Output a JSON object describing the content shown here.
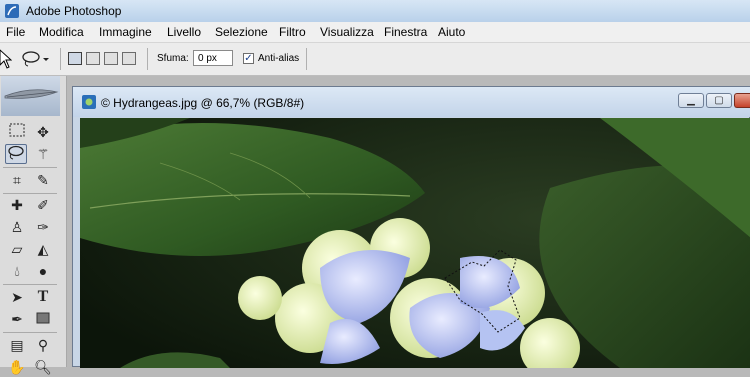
{
  "window": {
    "title": "Adobe Photoshop"
  },
  "menu": {
    "items": [
      "File",
      "Modifica",
      "Immagine",
      "Livello",
      "Selezione",
      "Filtro",
      "Visualizza",
      "Finestra",
      "Aiuto"
    ]
  },
  "options": {
    "feather_label": "Sfuma:",
    "feather_value": "0 px",
    "antialias_label": "Anti-alias",
    "antialias_checked": true
  },
  "document": {
    "title": "© Hydrangeas.jpg @ 66,7% (RGB/8#)",
    "zoom": "66,7%"
  },
  "tools": {
    "active": "lasso-tool",
    "items": [
      "rectangular-marquee",
      "move",
      "lasso",
      "magic-wand",
      "crop",
      "slice",
      "healing-brush",
      "brush",
      "clone-stamp",
      "history-brush",
      "eraser",
      "paint-bucket",
      "blur",
      "dodge",
      "path-selection",
      "type",
      "pen",
      "rectangle",
      "notes",
      "eyedropper",
      "hand",
      "zoom"
    ]
  },
  "colors": {
    "titlebar": "#b9d1ea",
    "accent": "#3d6fb5"
  }
}
